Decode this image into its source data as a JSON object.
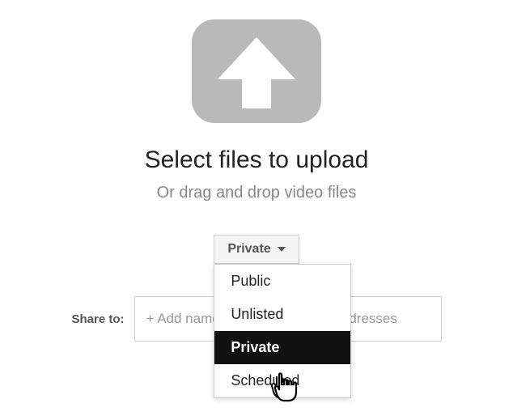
{
  "upload": {
    "heading": "Select files to upload",
    "subheading": "Or drag and drop video files"
  },
  "privacy": {
    "selected": "Private",
    "options": [
      "Public",
      "Unlisted",
      "Private",
      "Scheduled"
    ],
    "hovered_index": 2
  },
  "share": {
    "label": "Share to:",
    "placeholder": "+ Add names, circles, or email addresses"
  }
}
